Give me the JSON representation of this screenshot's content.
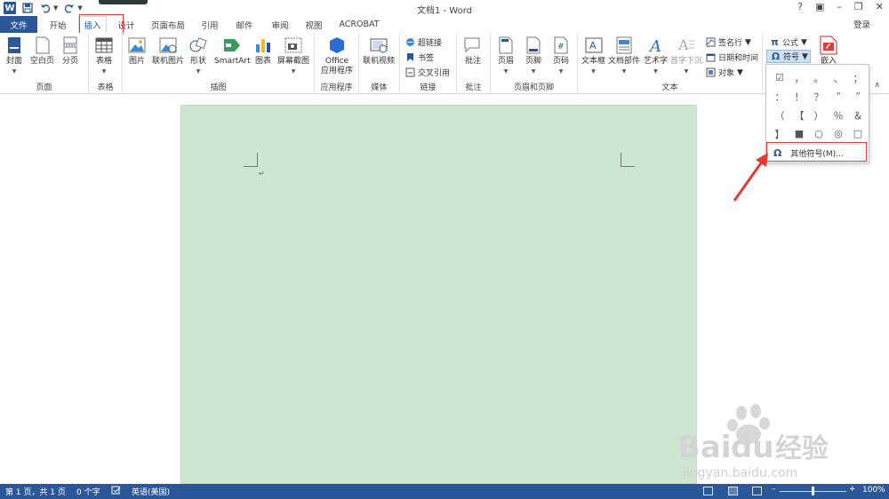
{
  "window": {
    "title": "文档1 - Word",
    "help": "?",
    "login": "登录"
  },
  "tabs": [
    {
      "label": "文件"
    },
    {
      "label": "开始"
    },
    {
      "label": "插入"
    },
    {
      "label": "设计"
    },
    {
      "label": "页面布局"
    },
    {
      "label": "引用"
    },
    {
      "label": "邮件"
    },
    {
      "label": "审阅"
    },
    {
      "label": "视图"
    },
    {
      "label": "ACROBAT"
    }
  ],
  "ribbon": {
    "groups": {
      "pages": "页面",
      "tables": "表格",
      "illustrations": "插图",
      "apps": "应用程序",
      "media": "媒体",
      "links": "链接",
      "comments": "批注",
      "header_footer": "页眉和页脚",
      "text": "文本"
    },
    "buttons": {
      "cover": "封面",
      "blank_page": "空白页",
      "page_break": "分页",
      "table": "表格",
      "picture": "图片",
      "online_picture": "联机图片",
      "shapes": "形状",
      "smartart": "SmartArt",
      "chart": "图表",
      "screenshot": "屏幕截图",
      "office_apps_line1": "Office",
      "office_apps_line2": "应用程序",
      "online_video": "联机视频",
      "hyperlink": "超链接",
      "bookmark": "书签",
      "cross_reference": "交叉引用",
      "comment": "批注",
      "header": "页眉",
      "footer": "页脚",
      "page_number": "页码",
      "text_box": "文本框",
      "quick_parts": "文档部件",
      "wordart": "艺术字",
      "drop_cap": "首字下沉",
      "signature_line": "签名行",
      "date_time": "日期和时间",
      "object": "对象",
      "equation": "公式",
      "symbol": "符号",
      "embed": "嵌入"
    }
  },
  "symbol_menu": {
    "symbols": [
      "☑",
      "，",
      "。",
      "、",
      "；",
      "：",
      "！",
      "？",
      "“",
      "”",
      "（",
      "【",
      "）",
      "％",
      "＆",
      "】",
      "■",
      "○",
      "◎",
      "□"
    ],
    "more_label": "其他符号(M)..."
  },
  "statusbar": {
    "page": "第 1 页，共 1 页",
    "words": "0 个字",
    "language": "英语(美国)",
    "zoom": "100%"
  },
  "watermark": {
    "brand": "Bai",
    "brand2": "du",
    "cn": "经验",
    "url": "jingyan.baidu.com"
  }
}
